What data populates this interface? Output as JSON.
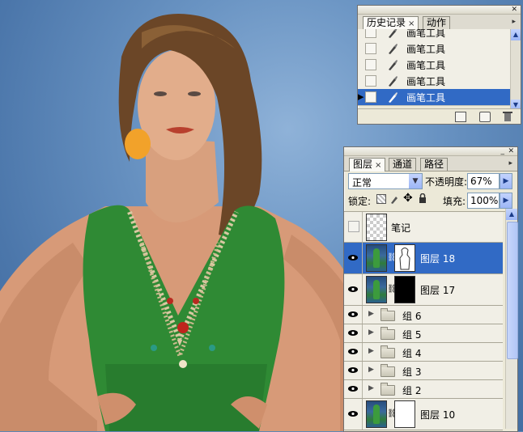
{
  "history_panel": {
    "tabs": [
      {
        "label": "历史记录",
        "close": "×",
        "active": true
      },
      {
        "label": "动作",
        "active": false
      }
    ],
    "items": [
      {
        "label": "画笔工具",
        "selected": false
      },
      {
        "label": "画笔工具",
        "selected": false
      },
      {
        "label": "画笔工具",
        "selected": false
      },
      {
        "label": "画笔工具",
        "selected": false
      },
      {
        "label": "画笔工具",
        "selected": true
      }
    ],
    "footer_icons": [
      "new-document-from-state-icon",
      "new-snapshot-icon",
      "trash-icon"
    ]
  },
  "layers_panel": {
    "tabs": [
      {
        "label": "图层",
        "close": "×",
        "active": true
      },
      {
        "label": "通道",
        "active": false
      },
      {
        "label": "路径",
        "active": false
      }
    ],
    "blend_mode": "正常",
    "opacity_label": "不透明度:",
    "opacity_value": "67%",
    "lock_label": "锁定:",
    "fill_label": "填充:",
    "fill_value": "100%",
    "layers": [
      {
        "name": "笔记",
        "visible": false,
        "kind": "transparent"
      },
      {
        "name": "图层 18",
        "visible": true,
        "kind": "masked",
        "mask": "white-figure",
        "selected": true
      },
      {
        "name": "图层 17",
        "visible": true,
        "kind": "masked",
        "mask": "black"
      },
      {
        "name": "组 6",
        "visible": true,
        "kind": "group"
      },
      {
        "name": "组 5",
        "visible": true,
        "kind": "group"
      },
      {
        "name": "组 4",
        "visible": true,
        "kind": "group"
      },
      {
        "name": "组 3",
        "visible": true,
        "kind": "group"
      },
      {
        "name": "组 2",
        "visible": true,
        "kind": "group"
      },
      {
        "name": "图层 10",
        "visible": true,
        "kind": "masked",
        "mask": "white"
      }
    ]
  },
  "colors": {
    "selection": "#316ac5",
    "panel_bg": "#ece9d8",
    "dress": "#2f8a34",
    "backdrop": "#5d86b5"
  }
}
